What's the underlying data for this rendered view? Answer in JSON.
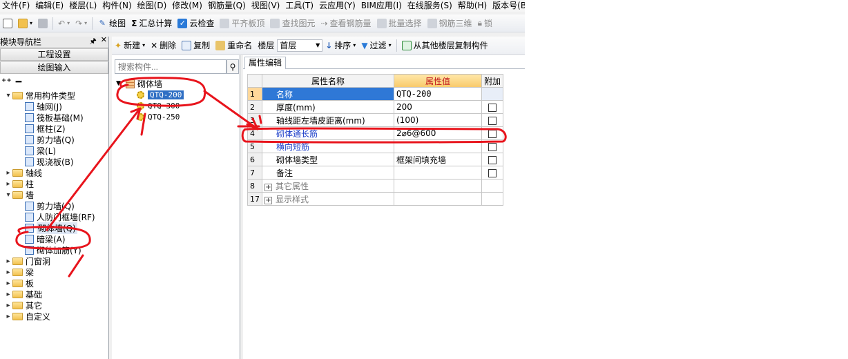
{
  "menu": [
    "文件(F)",
    "编辑(E)",
    "楼层(L)",
    "构件(N)",
    "绘图(D)",
    "修改(M)",
    "钢筋量(Q)",
    "视图(V)",
    "工具(T)",
    "云应用(Y)",
    "BIM应用(I)",
    "在线服务(S)",
    "帮助(H)",
    "版本号(B)"
  ],
  "toolbar1": {
    "draw": "绘图",
    "sum": "汇总计算",
    "cloud_check": "云检查",
    "flat_top": "平齐板顶",
    "find": "查找图元",
    "view_rebar": "查看钢筋量",
    "batch_select": "批量选择",
    "rebar_3d": "钢筋三维",
    "lock": "锁"
  },
  "toolbar2": {
    "new": "新建",
    "delete": "删除",
    "copy": "复制",
    "rename": "重命名",
    "floor_label": "楼层",
    "floor_value": "首层",
    "sort": "排序",
    "filter": "过滤",
    "copy_from_floor": "从其他楼层复制构件"
  },
  "nav": {
    "title": "模块导航栏",
    "btn_project": "工程设置",
    "btn_draw": "绘图输入",
    "tree": [
      {
        "label": "常用构件类型",
        "level": 0,
        "expanded": true
      },
      {
        "label": "轴网(J)",
        "level": 1
      },
      {
        "label": "筏板基础(M)",
        "level": 1
      },
      {
        "label": "框柱(Z)",
        "level": 1
      },
      {
        "label": "剪力墙(Q)",
        "level": 1
      },
      {
        "label": "梁(L)",
        "level": 1
      },
      {
        "label": "现浇板(B)",
        "level": 1
      },
      {
        "label": "轴线",
        "level": 0,
        "expanded": false
      },
      {
        "label": "柱",
        "level": 0,
        "expanded": false
      },
      {
        "label": "墙",
        "level": 0,
        "expanded": true
      },
      {
        "label": "剪力墙(Q)",
        "level": 1
      },
      {
        "label": "人防门框墙(RF)",
        "level": 1
      },
      {
        "label": "砌体墙(Q)",
        "level": 1,
        "selected": true
      },
      {
        "label": "暗梁(A)",
        "level": 1
      },
      {
        "label": "砌体加筋(Y)",
        "level": 1
      },
      {
        "label": "门窗洞",
        "level": 0,
        "expanded": false
      },
      {
        "label": "梁",
        "level": 0,
        "expanded": false
      },
      {
        "label": "板",
        "level": 0,
        "expanded": false
      },
      {
        "label": "基础",
        "level": 0,
        "expanded": false
      },
      {
        "label": "其它",
        "level": 0,
        "expanded": false
      },
      {
        "label": "自定义",
        "level": 0,
        "expanded": false
      }
    ]
  },
  "components": {
    "search_placeholder": "搜索构件...",
    "root": "砌体墙",
    "items": [
      "QTQ-200",
      "QTQ-300",
      "QTQ-250"
    ],
    "selected_index": 0
  },
  "properties": {
    "tab": "属性编辑",
    "headers": [
      "属性名称",
      "属性值",
      "附加"
    ],
    "rows": [
      {
        "num": "1",
        "name": "名称",
        "value": "QTQ-200",
        "check": false,
        "style": "selected"
      },
      {
        "num": "2",
        "name": "厚度(mm)",
        "value": "200",
        "check": true,
        "style": "normal"
      },
      {
        "num": "3",
        "name": "轴线距左墙皮距离(mm)",
        "value": "(100)",
        "check": true,
        "style": "normal"
      },
      {
        "num": "4",
        "name": "砌体通长筋",
        "value": "2⌀6@600",
        "check": true,
        "style": "blue"
      },
      {
        "num": "5",
        "name": "横向短筋",
        "value": "",
        "check": true,
        "style": "blue"
      },
      {
        "num": "6",
        "name": "砌体墙类型",
        "value": "框架间填充墙",
        "check": true,
        "style": "normal"
      },
      {
        "num": "7",
        "name": "备注",
        "value": "",
        "check": true,
        "style": "normal"
      },
      {
        "num": "8",
        "name": "其它属性",
        "value": "",
        "check": false,
        "style": "group"
      },
      {
        "num": "17",
        "name": "显示样式",
        "value": "",
        "check": false,
        "style": "group"
      }
    ]
  },
  "colors": {
    "annotation": "#e8141c",
    "selection": "#2f6fc4",
    "header_value": "#c0141b"
  }
}
